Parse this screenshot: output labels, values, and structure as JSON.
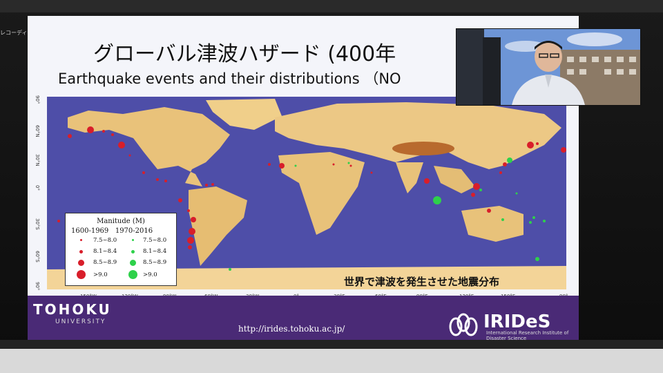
{
  "app": {
    "window_label": "レコーディング..."
  },
  "slide": {
    "title_jp": "グローバル津波ハザード (400年",
    "title_en": "Earthquake events and their distributions  （NO",
    "caption_jp": "世界で津波を発生させた地震分布",
    "legend": {
      "title": "Manitude (M)",
      "period_old": "1600-1969",
      "period_new": "1970-2016",
      "ranges": [
        "7.5~8.0",
        "8.1~8.4",
        "8.5~8.9",
        ">9.0"
      ]
    },
    "lat_labels": [
      "90°",
      "60°N",
      "30°N",
      "0°",
      "30°S",
      "60°S",
      "90°"
    ],
    "lon_labels": [
      "150°W",
      "120°W",
      "90°W",
      "60°W",
      "30°W",
      "0°",
      "30°E",
      "60°E",
      "90°E",
      "120°E",
      "150°E",
      "90°"
    ],
    "footer": {
      "university": "TOHOKU",
      "university_sub": "UNIVERSITY",
      "url": "http://irides.tohoku.ac.jp/",
      "institute": "IRIDeS",
      "institute_sub": "International Research Institute of Disaster Science"
    }
  },
  "colors": {
    "old_events": "#d81e2a",
    "new_events": "#2ed14a",
    "footer": "#4a2a76",
    "ocean": "#4e4ea8",
    "land": "#e9c27a"
  }
}
